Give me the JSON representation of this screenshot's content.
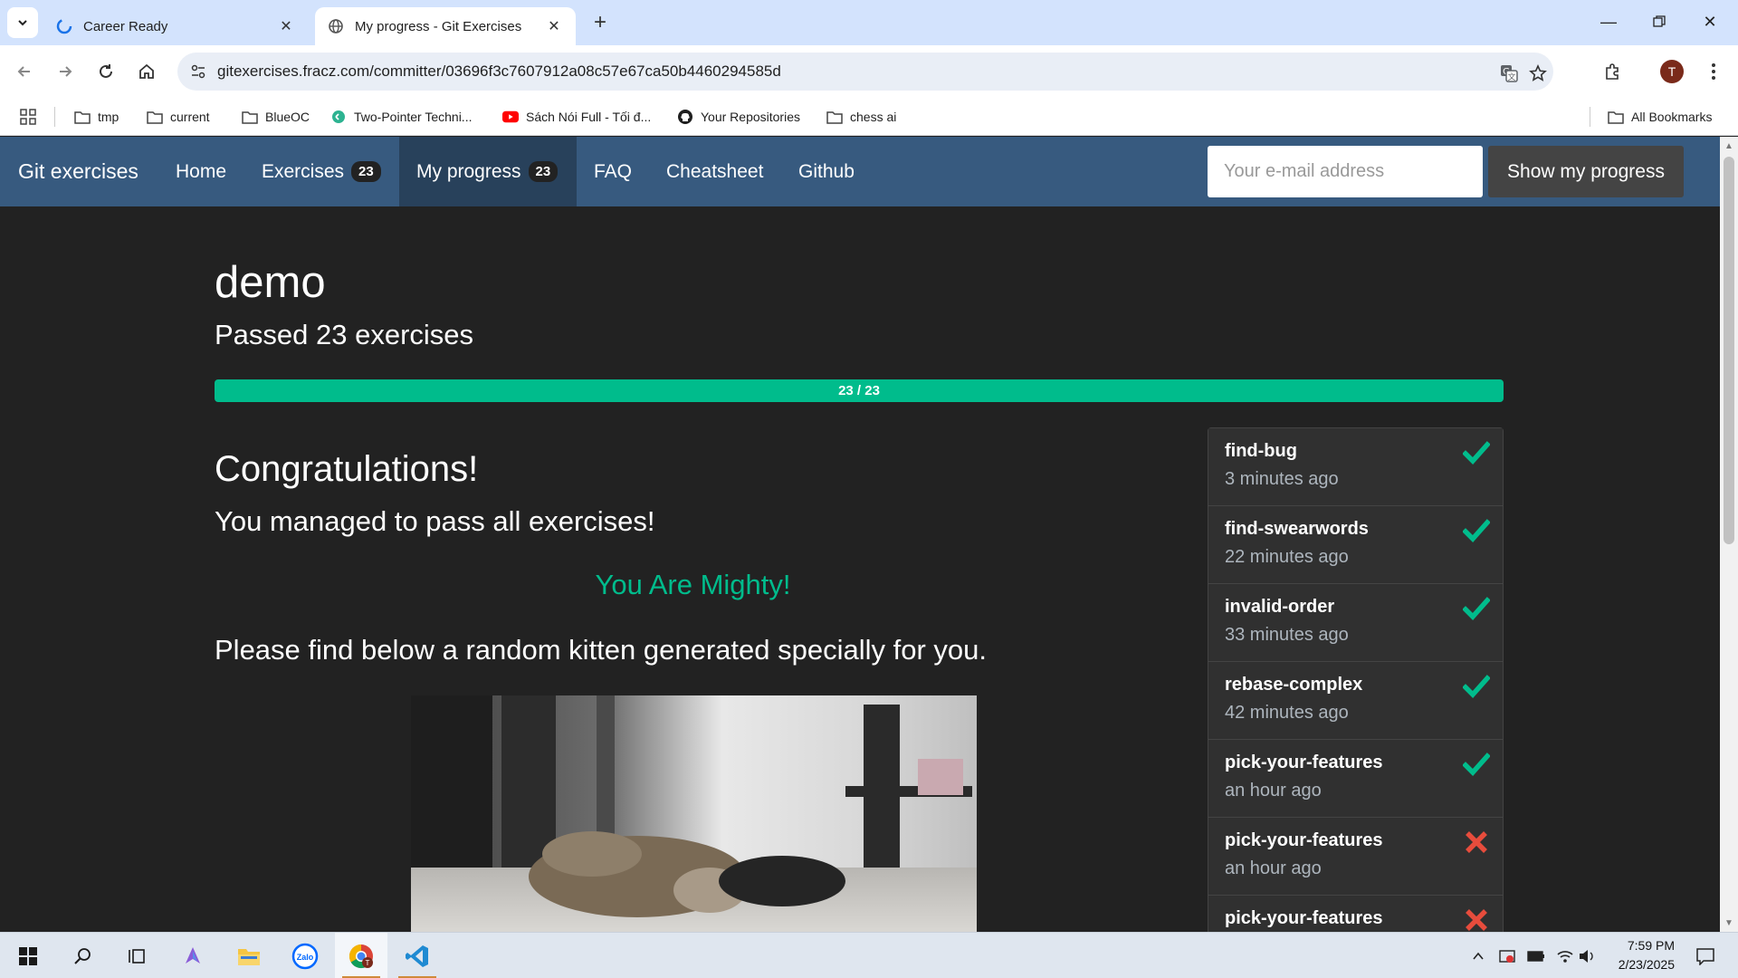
{
  "browser": {
    "tabs": [
      {
        "title": "Career Ready",
        "active": false
      },
      {
        "title": "My progress - Git Exercises",
        "active": true
      }
    ],
    "url": "gitexercises.fracz.com/committer/03696f3c7607912a08c57e67ca50b4460294585d",
    "bookmarks": [
      {
        "label": "tmp",
        "icon": "folder-icon"
      },
      {
        "label": "current",
        "icon": "folder-icon"
      },
      {
        "label": "BlueOC",
        "icon": "folder-icon"
      },
      {
        "label": "Two-Pointer Techni...",
        "icon": "leetcode-icon"
      },
      {
        "label": "Sách Nói Full - Tối đ...",
        "icon": "youtube-icon"
      },
      {
        "label": "Your Repositories",
        "icon": "github-icon"
      },
      {
        "label": "chess ai",
        "icon": "folder-icon"
      }
    ],
    "all_bookmarks": "All Bookmarks",
    "profile_initial": "T"
  },
  "nav": {
    "brand": "Git exercises",
    "home": "Home",
    "exercises": "Exercises",
    "exercises_count": "23",
    "progress": "My progress",
    "progress_count": "23",
    "faq": "FAQ",
    "cheatsheet": "Cheatsheet",
    "github": "Github",
    "email_placeholder": "Your e-mail address",
    "show_button": "Show my progress"
  },
  "main": {
    "name": "demo",
    "passed": "Passed 23 exercises",
    "progress_label": "23 / 23",
    "progress_fraction": 1.0,
    "congrats": "Congratulations!",
    "managed": "You managed to pass all exercises!",
    "mighty": "You Are Mighty!",
    "kitten_text": "Please find below a random kitten generated specially for you."
  },
  "exercises": [
    {
      "name": "find-bug",
      "time": "3 minutes ago",
      "status": "passed"
    },
    {
      "name": "find-swearwords",
      "time": "22 minutes ago",
      "status": "passed"
    },
    {
      "name": "invalid-order",
      "time": "33 minutes ago",
      "status": "passed"
    },
    {
      "name": "rebase-complex",
      "time": "42 minutes ago",
      "status": "passed"
    },
    {
      "name": "pick-your-features",
      "time": "an hour ago",
      "status": "passed"
    },
    {
      "name": "pick-your-features",
      "time": "an hour ago",
      "status": "failed"
    },
    {
      "name": "pick-your-features",
      "time": "",
      "status": "failed"
    }
  ],
  "taskbar": {
    "time": "7:59 PM",
    "date": "2/23/2025"
  },
  "colors": {
    "navbar": "#375a7f",
    "success": "#00bc8c",
    "failed": "#e74c3c",
    "background": "#222222"
  }
}
